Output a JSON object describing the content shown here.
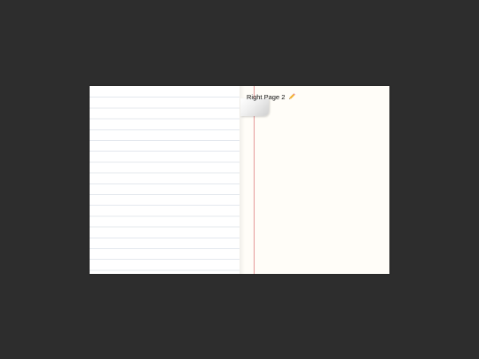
{
  "notebook": {
    "right_page": {
      "title": "Right Page 2",
      "title_icon": "pencil-icon"
    }
  },
  "colors": {
    "background": "#2d2d2d",
    "left_page": "#ffffff",
    "right_page": "#fffdf8",
    "rule_line": "#e4e8ee",
    "margin_line": "#e69a9a"
  }
}
